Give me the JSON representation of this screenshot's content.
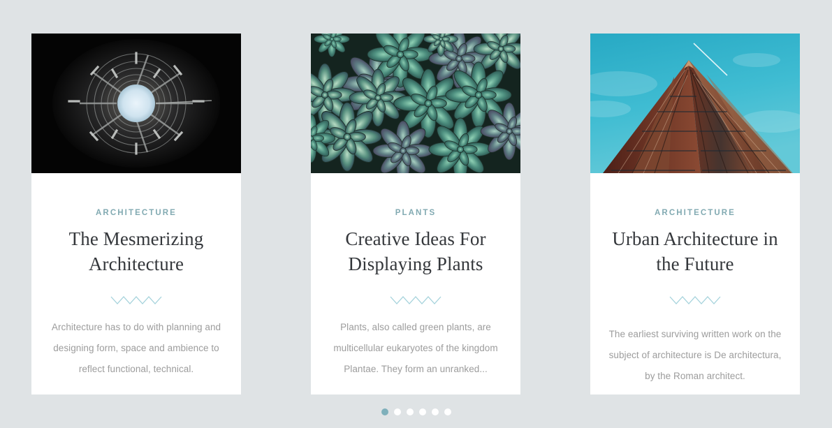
{
  "background_color": "#dfe3e5",
  "accent_color": "#82aab2",
  "divider_color": "#a6d3dc",
  "title_color": "#34373b",
  "body_text_color": "#9c9c9c",
  "cards": [
    {
      "category": "ARCHITECTURE",
      "title": "The Mesmerizing Architecture",
      "excerpt": "Architecture has to do with planning and designing form, space and ambience to reflect functional, technical.",
      "image_name": "spiral-tower-looking-up",
      "image_alt": "Dark spiral wooden tower interior looking up at a bright circular sky opening"
    },
    {
      "category": "PLANTS",
      "title": "Creative Ideas For Displaying Plants",
      "excerpt": "Plants, also called green plants, are multicellular eukaryotes of the kingdom Plantae. They form an unranked...",
      "image_name": "succulent-rosettes",
      "image_alt": "Dense cluster of green and purple echeveria succulent rosettes"
    },
    {
      "category": "ARCHITECTURE",
      "title": "Urban Architecture in the Future",
      "excerpt": "The earliest surviving written work on the subject of architecture is De architectura, by the Roman architect.",
      "image_name": "skyscraper-upward-view",
      "image_alt": "Art deco brick skyscraper photographed from below against a teal sky with a contrail"
    }
  ],
  "pagination": {
    "total": 6,
    "active_index": 0,
    "active_color": "#7fb0bb",
    "inactive_color": "#ffffff"
  }
}
